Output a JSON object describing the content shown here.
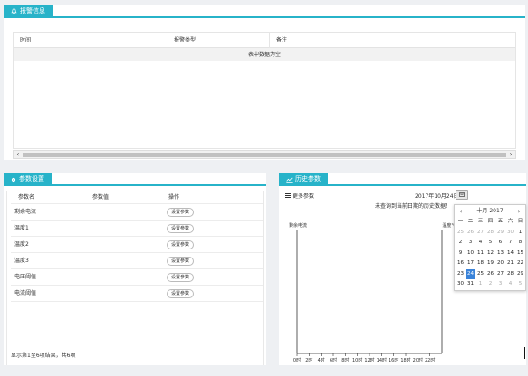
{
  "alarm": {
    "title": "报警信息",
    "columns": [
      "时间",
      "报警类型",
      "备注"
    ],
    "empty_text": "表中数据为空"
  },
  "params": {
    "title": "参数设置",
    "columns": [
      "参数名",
      "参数值",
      "操作"
    ],
    "rows": [
      {
        "name": "剩余电流",
        "value": "",
        "action": "设置参数"
      },
      {
        "name": "温度1",
        "value": "",
        "action": "设置参数"
      },
      {
        "name": "温度2",
        "value": "",
        "action": "设置参数"
      },
      {
        "name": "温度3",
        "value": "",
        "action": "设置参数"
      },
      {
        "name": "电压阈值",
        "value": "",
        "action": "设置参数"
      },
      {
        "name": "电流阈值",
        "value": "",
        "action": "设置参数"
      }
    ],
    "footer": "显示第1至6项结果，共6项"
  },
  "history": {
    "title": "历史参数",
    "more_label": "更多参数",
    "date": "2017年10月24日",
    "no_data": "未查询到当前日期的历史数据！"
  },
  "chart_data": {
    "type": "line",
    "title": "",
    "ylabel_left": "剩余电流",
    "ylabel_right": "温度℃",
    "xlabel": "",
    "x_ticks": [
      "0时",
      "2时",
      "4时",
      "6时",
      "8时",
      "10时",
      "12时",
      "14时",
      "16时",
      "18时",
      "20时",
      "22时"
    ],
    "series": []
  },
  "calendar": {
    "prev": "‹",
    "next": "›",
    "title": "十月 2017",
    "weekdays": [
      "一",
      "二",
      "三",
      "四",
      "五",
      "六",
      "日"
    ],
    "days": [
      {
        "d": "25",
        "other": true
      },
      {
        "d": "26",
        "other": true
      },
      {
        "d": "27",
        "other": true
      },
      {
        "d": "28",
        "other": true
      },
      {
        "d": "29",
        "other": true
      },
      {
        "d": "30",
        "other": true
      },
      {
        "d": "1",
        "other": false
      },
      {
        "d": "2",
        "other": false
      },
      {
        "d": "3",
        "other": false
      },
      {
        "d": "4",
        "other": false
      },
      {
        "d": "5",
        "other": false
      },
      {
        "d": "6",
        "other": false
      },
      {
        "d": "7",
        "other": false
      },
      {
        "d": "8",
        "other": false
      },
      {
        "d": "9",
        "other": false
      },
      {
        "d": "10",
        "other": false
      },
      {
        "d": "11",
        "other": false
      },
      {
        "d": "12",
        "other": false
      },
      {
        "d": "13",
        "other": false
      },
      {
        "d": "14",
        "other": false
      },
      {
        "d": "15",
        "other": false
      },
      {
        "d": "16",
        "other": false
      },
      {
        "d": "17",
        "other": false
      },
      {
        "d": "18",
        "other": false
      },
      {
        "d": "19",
        "other": false
      },
      {
        "d": "20",
        "other": false
      },
      {
        "d": "21",
        "other": false
      },
      {
        "d": "22",
        "other": false
      },
      {
        "d": "23",
        "other": false
      },
      {
        "d": "24",
        "other": false,
        "selected": true
      },
      {
        "d": "25",
        "other": false
      },
      {
        "d": "26",
        "other": false
      },
      {
        "d": "27",
        "other": false
      },
      {
        "d": "28",
        "other": false
      },
      {
        "d": "29",
        "other": false
      },
      {
        "d": "30",
        "other": false
      },
      {
        "d": "31",
        "other": false
      },
      {
        "d": "1",
        "other": true
      },
      {
        "d": "2",
        "other": true
      },
      {
        "d": "3",
        "other": true
      },
      {
        "d": "4",
        "other": true
      },
      {
        "d": "5",
        "other": true
      }
    ]
  },
  "colors": {
    "accent": "#27b3c9",
    "selected": "#3a83d9"
  }
}
